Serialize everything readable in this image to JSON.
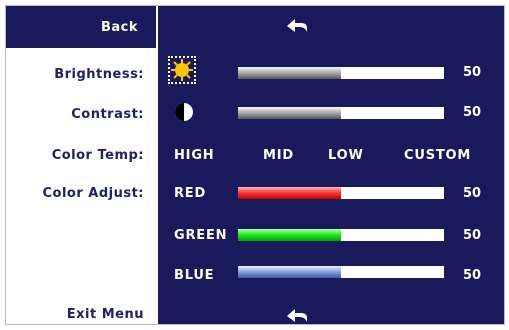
{
  "menu": {
    "back_label": "Back",
    "exit_label": "Exit Menu",
    "back_icon": "return-arrow-icon",
    "exit_icon": "return-arrow-icon"
  },
  "brightness": {
    "label": "Brightness:",
    "value": "50",
    "level": 0.5,
    "icon": "sun-icon"
  },
  "contrast": {
    "label": "Contrast:",
    "value": "50",
    "level": 0.5,
    "icon": "contrast-icon"
  },
  "color_temp": {
    "label": "Color Temp:",
    "options": [
      "HIGH",
      "MID",
      "LOW",
      "CUSTOM"
    ]
  },
  "color_adjust": {
    "label": "Color Adjust:",
    "channels": [
      {
        "name": "RED",
        "value": "50",
        "level": 0.5,
        "color": "#ff3b3b"
      },
      {
        "name": "GREEN",
        "value": "50",
        "level": 0.5,
        "color": "#22ee22"
      },
      {
        "name": "BLUE",
        "value": "50",
        "level": 0.5,
        "color": "#8ea4de"
      }
    ]
  },
  "colors": {
    "panel": "#181a5c",
    "label_text": "#1e2266",
    "highlight_icon": "#ffc400"
  }
}
